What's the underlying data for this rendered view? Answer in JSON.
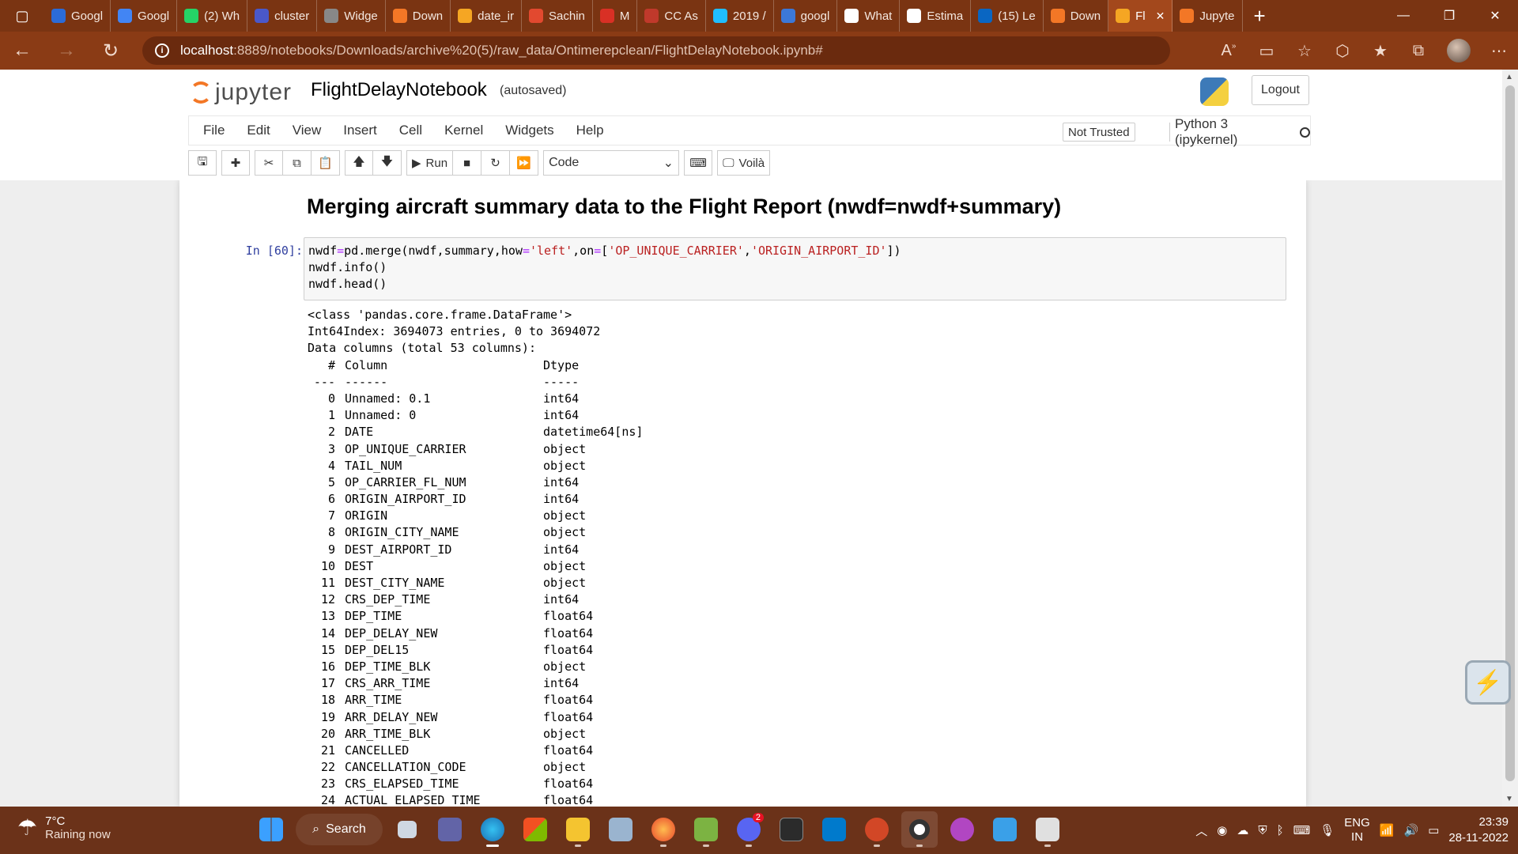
{
  "browser": {
    "tabs": [
      {
        "label": "Googl",
        "color": "#2b6bd8"
      },
      {
        "label": "Googl",
        "color": "#4285f4"
      },
      {
        "label": "(2) Wh",
        "color": "#25d366"
      },
      {
        "label": "cluster",
        "color": "#4a58c9"
      },
      {
        "label": "Widge",
        "color": "#888888"
      },
      {
        "label": "Down",
        "color": "#f37726"
      },
      {
        "label": "date_ir",
        "color": "#f5a623"
      },
      {
        "label": "Sachin",
        "color": "#e2492f"
      },
      {
        "label": "M",
        "color": "#d93025"
      },
      {
        "label": "CC As",
        "color": "#c0392b"
      },
      {
        "label": "2019 /",
        "color": "#20beff"
      },
      {
        "label": "googl",
        "color": "#3c78d8"
      },
      {
        "label": "What",
        "color": "#ffffff"
      },
      {
        "label": "Estima",
        "color": "#ffffff"
      },
      {
        "label": "(15) Le",
        "color": "#0a66c2"
      },
      {
        "label": "Down",
        "color": "#f37726"
      },
      {
        "label": "Fl",
        "color": "#f5a623",
        "active": true
      },
      {
        "label": "Jupyte",
        "color": "#f37726"
      }
    ],
    "url_host": "localhost",
    "url_path": ":8889/notebooks/Downloads/archive%20(5)/raw_data/Ontimerepclean/FlightDelayNotebook.ipynb#"
  },
  "jupyter": {
    "logo_text": "jupyter",
    "notebook_title": "FlightDelayNotebook",
    "autosave_status": "(autosaved)",
    "logout_label": "Logout",
    "menu": [
      "File",
      "Edit",
      "View",
      "Insert",
      "Cell",
      "Kernel",
      "Widgets",
      "Help"
    ],
    "trust_status": "Not Trusted",
    "kernel_name": "Python 3 (ipykernel)",
    "toolbar": {
      "run_label": "Run",
      "cell_type": "Code",
      "voila_label": "Voilà"
    }
  },
  "notebook": {
    "markdown_heading": "Merging aircraft summary data to the Flight Report (nwdf=nwdf+summary)",
    "prompt": "In [60]:",
    "output_header": [
      "<class 'pandas.core.frame.DataFrame'>",
      "Int64Index: 3694073 entries, 0 to 3694072",
      "Data columns (total 53 columns):"
    ],
    "table_header": [
      "#",
      "Column",
      "Dtype"
    ],
    "table_separator": [
      "---",
      "------",
      "-----"
    ],
    "columns": [
      [
        "0",
        "Unnamed: 0.1",
        "int64"
      ],
      [
        "1",
        "Unnamed: 0",
        "int64"
      ],
      [
        "2",
        "DATE",
        "datetime64[ns]"
      ],
      [
        "3",
        "OP_UNIQUE_CARRIER",
        "object"
      ],
      [
        "4",
        "TAIL_NUM",
        "object"
      ],
      [
        "5",
        "OP_CARRIER_FL_NUM",
        "int64"
      ],
      [
        "6",
        "ORIGIN_AIRPORT_ID",
        "int64"
      ],
      [
        "7",
        "ORIGIN",
        "object"
      ],
      [
        "8",
        "ORIGIN_CITY_NAME",
        "object"
      ],
      [
        "9",
        "DEST_AIRPORT_ID",
        "int64"
      ],
      [
        "10",
        "DEST",
        "object"
      ],
      [
        "11",
        "DEST_CITY_NAME",
        "object"
      ],
      [
        "12",
        "CRS_DEP_TIME",
        "int64"
      ],
      [
        "13",
        "DEP_TIME",
        "float64"
      ],
      [
        "14",
        "DEP_DELAY_NEW",
        "float64"
      ],
      [
        "15",
        "DEP_DEL15",
        "float64"
      ],
      [
        "16",
        "DEP_TIME_BLK",
        "object"
      ],
      [
        "17",
        "CRS_ARR_TIME",
        "int64"
      ],
      [
        "18",
        "ARR_TIME",
        "float64"
      ],
      [
        "19",
        "ARR_DELAY_NEW",
        "float64"
      ],
      [
        "20",
        "ARR_TIME_BLK",
        "object"
      ],
      [
        "21",
        "CANCELLED",
        "float64"
      ],
      [
        "22",
        "CANCELLATION_CODE",
        "object"
      ],
      [
        "23",
        "CRS_ELAPSED_TIME",
        "float64"
      ],
      [
        "24",
        "ACTUAL_ELAPSED_TIME",
        "float64"
      ]
    ]
  },
  "taskbar": {
    "temperature": "7°C",
    "weather": "Raining now",
    "search_label": "Search",
    "discord_badge": "2",
    "lang_top": "ENG",
    "lang_bottom": "IN",
    "time": "23:39",
    "date": "28-11-2022"
  }
}
